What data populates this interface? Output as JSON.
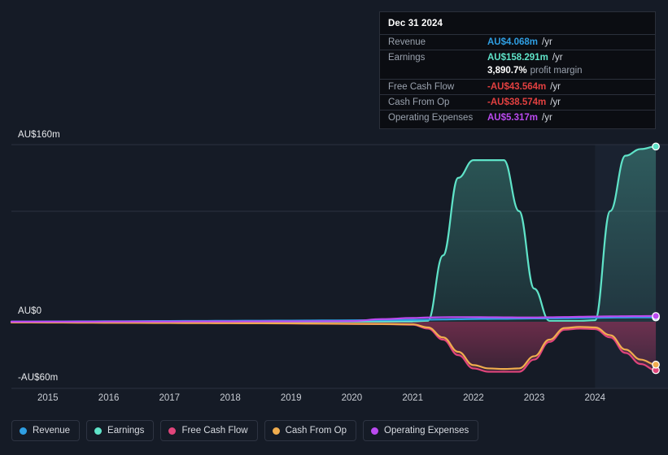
{
  "chart_data": {
    "type": "area",
    "title": "",
    "xlabel": "",
    "ylabel": "",
    "currency": "AU$",
    "grid": true,
    "legend_position": "bottom",
    "ylim": [
      -60,
      160
    ],
    "y_ticks": [
      {
        "value": 160,
        "label": "AU$160m"
      },
      {
        "value": 0,
        "label": "AU$0"
      },
      {
        "value": -60,
        "label": "-AU$60m"
      }
    ],
    "x_ticks": [
      "2015",
      "2016",
      "2017",
      "2018",
      "2019",
      "2020",
      "2021",
      "2022",
      "2023",
      "2024"
    ],
    "xlim": [
      2014.4,
      2025.2
    ],
    "forecast_starts": 2024.0,
    "x": [
      2014.4,
      2015,
      2015.5,
      2016,
      2016.5,
      2017,
      2017.5,
      2018,
      2018.5,
      2019,
      2019.5,
      2020,
      2020.5,
      2021,
      2021.25,
      2021.5,
      2021.75,
      2022,
      2022.25,
      2022.5,
      2022.75,
      2023,
      2023.25,
      2023.5,
      2023.75,
      2024,
      2024.25,
      2024.5,
      2024.75,
      2025.0
    ],
    "series": [
      {
        "name": "Revenue",
        "color": "#2f9fe3",
        "values": [
          0.3,
          0.4,
          0.5,
          0.6,
          0.7,
          0.8,
          0.9,
          1.0,
          1.1,
          1.2,
          1.3,
          1.4,
          1.6,
          1.8,
          2.0,
          2.2,
          2.4,
          2.6,
          2.7,
          2.8,
          3.0,
          3.1,
          3.2,
          3.3,
          3.5,
          3.7,
          3.9,
          4.0,
          4.05,
          4.068
        ]
      },
      {
        "name": "Earnings",
        "color": "#5fe3c8",
        "values": [
          0.1,
          0.1,
          0.1,
          0.1,
          0.1,
          0.2,
          0.2,
          0.2,
          0.2,
          0.3,
          0.3,
          0.3,
          0.4,
          0.5,
          1.0,
          60.0,
          130.0,
          146.0,
          146.0,
          146.0,
          100.0,
          30.0,
          1.0,
          1.0,
          1.0,
          1.5,
          100.0,
          150.0,
          156.0,
          158.291
        ]
      },
      {
        "name": "Free Cash Flow",
        "color": "#e0457b",
        "values": [
          -0.5,
          -0.6,
          -0.7,
          -0.8,
          -0.9,
          -1.0,
          -1.1,
          -1.2,
          -1.3,
          -1.4,
          -1.6,
          -1.8,
          -2.0,
          -2.5,
          -6.0,
          -16.0,
          -30.0,
          -42.0,
          -45.0,
          -45.0,
          -45.0,
          -34.0,
          -18.0,
          -7.0,
          -6.0,
          -6.5,
          -14.0,
          -28.0,
          -38.0,
          -43.564
        ]
      },
      {
        "name": "Cash From Op",
        "color": "#f0ad4e",
        "values": [
          -0.4,
          -0.5,
          -0.6,
          -0.7,
          -0.8,
          -0.9,
          -1.0,
          -1.1,
          -1.2,
          -1.3,
          -1.5,
          -1.7,
          -1.9,
          -2.2,
          -5.0,
          -14.0,
          -27.0,
          -39.0,
          -42.0,
          -42.5,
          -42.0,
          -31.0,
          -16.0,
          -5.5,
          -4.5,
          -5.0,
          -12.0,
          -25.0,
          -34.0,
          -38.574
        ]
      },
      {
        "name": "Operating Expenses",
        "color": "#bb4af0",
        "values": [
          0.2,
          0.2,
          0.2,
          0.3,
          0.3,
          0.3,
          0.4,
          0.4,
          0.5,
          0.5,
          0.6,
          0.8,
          2.5,
          3.5,
          4.0,
          4.2,
          4.3,
          4.3,
          4.2,
          4.1,
          4.0,
          4.0,
          4.2,
          4.4,
          4.6,
          4.8,
          5.0,
          5.1,
          5.2,
          5.317
        ]
      }
    ],
    "end_markers": [
      {
        "name": "Earnings",
        "value": 158.291
      },
      {
        "name": "Operating Expenses",
        "value": 5.317
      },
      {
        "name": "Revenue",
        "value": 4.068
      },
      {
        "name": "Cash From Op",
        "value": -38.574
      },
      {
        "name": "Free Cash Flow",
        "value": -43.564
      }
    ]
  },
  "tooltip": {
    "title": "Dec 31 2024",
    "rows": [
      {
        "name": "Revenue",
        "value": "AU$4.068m",
        "unit": "/yr",
        "color": "#2f9fe3"
      },
      {
        "name": "Earnings",
        "value": "AU$158.291m",
        "unit": "/yr",
        "color": "#5fe3c8"
      },
      {
        "name": "Free Cash Flow",
        "value": "-AU$43.564m",
        "unit": "/yr",
        "color": "#e34040"
      },
      {
        "name": "Cash From Op",
        "value": "-AU$38.574m",
        "unit": "/yr",
        "color": "#e34040"
      },
      {
        "name": "Operating Expenses",
        "value": "AU$5.317m",
        "unit": "/yr",
        "color": "#bb4af0"
      }
    ],
    "margin_value": "3,890.7%",
    "margin_label": "profit margin"
  },
  "legend": {
    "items": [
      {
        "label": "Revenue",
        "color": "#2f9fe3"
      },
      {
        "label": "Earnings",
        "color": "#5fe3c8"
      },
      {
        "label": "Free Cash Flow",
        "color": "#e0457b"
      },
      {
        "label": "Cash From Op",
        "color": "#f0ad4e"
      },
      {
        "label": "Operating Expenses",
        "color": "#bb4af0"
      }
    ]
  },
  "theme": {
    "background": "#151b26",
    "gridline": "#2b3240",
    "zeroline": "#e8eaed",
    "forecast_band": "#1a2230"
  }
}
